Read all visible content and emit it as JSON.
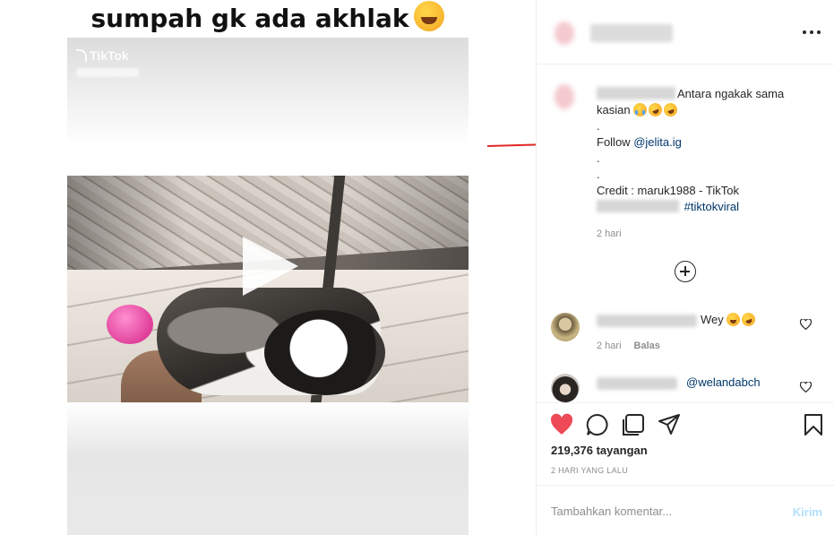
{
  "media": {
    "meme_title": "sumpah gk ada akhlak",
    "watermark": "TikTok",
    "play_icon": "play-icon"
  },
  "caption": {
    "line1_suffix": "Antara ngakak sama",
    "line2_text": "kasian",
    "dot1": ".",
    "follow_prefix": "Follow",
    "follow_mention": "@jelita.ig",
    "dot2": ".",
    "dot3": ".",
    "credit": "Credit : maruk1988 - TikTok",
    "hashtag": "#tiktokviral",
    "time": "2 hari"
  },
  "comments": [
    {
      "text": "Wey",
      "time": "2 hari",
      "reply": "Balas"
    },
    {
      "text": "@welandabch"
    }
  ],
  "actions": {
    "views": "219,376 tayangan",
    "ago": "2 HARI YANG LALU",
    "like_color": "#ed4956"
  },
  "compose": {
    "placeholder": "Tambahkan komentar...",
    "post": "Kirim"
  }
}
